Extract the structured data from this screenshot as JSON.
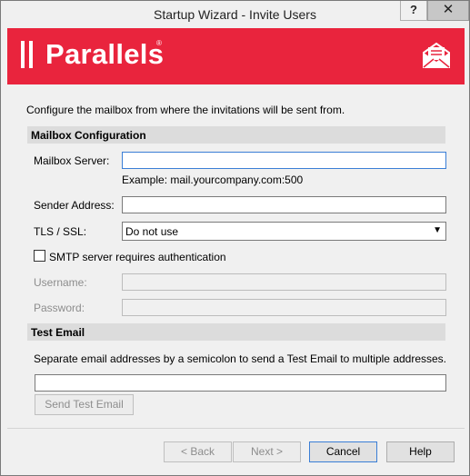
{
  "window": {
    "title": "Startup Wizard - Invite Users",
    "help_button": "?",
    "close_button": "✕"
  },
  "banner": {
    "logo_text": "Parallels",
    "logo_mark": "®",
    "icon": "envelope-icon",
    "color": "#e9243d"
  },
  "intro": "Configure the mailbox from where the invitations will be sent from.",
  "mailbox": {
    "header": "Mailbox Configuration",
    "server_label": "Mailbox Server:",
    "server_value": "",
    "server_hint": "Example: mail.yourcompany.com:500",
    "sender_label": "Sender Address:",
    "sender_value": "",
    "tls_label": "TLS / SSL:",
    "tls_value": "Do not use",
    "smtp_auth_label": "SMTP server requires authentication",
    "smtp_auth_checked": false,
    "username_label": "Username:",
    "password_label": "Password:"
  },
  "test": {
    "header": "Test Email",
    "description": "Separate email addresses by a semicolon to send a Test Email to multiple addresses.",
    "email_value": "",
    "send_button": "Send Test Email"
  },
  "footer": {
    "back": "< Back",
    "next": "Next >",
    "cancel": "Cancel",
    "help": "Help"
  }
}
